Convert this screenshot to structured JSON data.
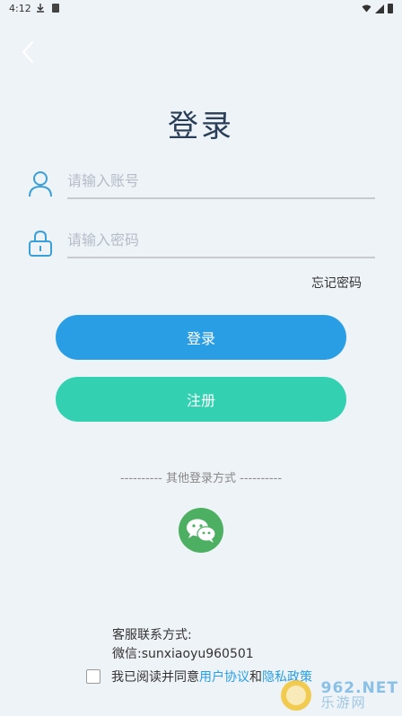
{
  "status_bar": {
    "time": "4:12"
  },
  "title": "登录",
  "account": {
    "placeholder": "请输入账号"
  },
  "password": {
    "placeholder": "请输入密码"
  },
  "forgot_password": "忘记密码",
  "login_button": "登录",
  "register_button": "注册",
  "other_login": "---------- 其他登录方式 ----------",
  "contact": {
    "title": "客服联系方式:",
    "wechat": "微信:sunxiaoyu960501"
  },
  "agreement": {
    "prefix": "我已阅读并同意",
    "user_agreement": "用户协议",
    "and": "和",
    "privacy_policy": "隐私政策"
  },
  "watermark": {
    "brand": "962.NET",
    "name": "乐游网"
  },
  "colors": {
    "background": "#eef3f7",
    "login_button": "#2a9ee4",
    "register_button": "#33d1b2",
    "wechat": "#4caf62",
    "link": "#2a9ee4",
    "icon": "#3a9fd8"
  }
}
